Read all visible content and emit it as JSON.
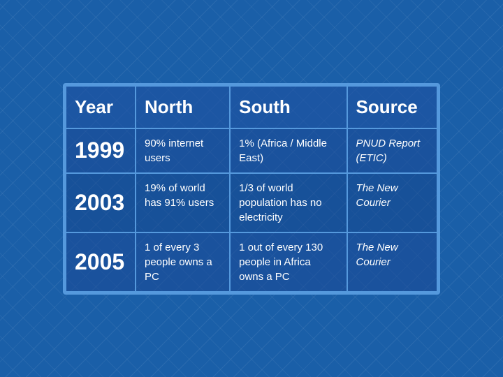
{
  "table": {
    "headers": {
      "year": "Year",
      "north": "North",
      "south": "South",
      "source": "Source"
    },
    "rows": [
      {
        "year": "1999",
        "north": "90% internet users",
        "south": "1% (Africa / Middle East)",
        "source": "PNUD Report (ETIC)"
      },
      {
        "year": "2003",
        "north": "19% of world has 91% users",
        "south": "1/3 of world population has no electricity",
        "source": "The New Courier"
      },
      {
        "year": "2005",
        "north": "1 of every 3 people owns a PC",
        "south": "1 out of every 130 people in Africa owns a PC",
        "source": "The New Courier"
      }
    ]
  }
}
